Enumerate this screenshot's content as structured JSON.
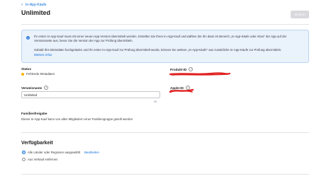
{
  "nav": {
    "back_label": "In-App-Käufe"
  },
  "header": {
    "title": "Unlimited",
    "save_label": "Sichern"
  },
  "info": {
    "paragraph1": "Ihr erster In-App-Kauf muss mit einer neuen App-Version übermittelt werden. Erstellen Sie Ihren In-App-Kauf und wählen Sie ihn dann im Bereich „In-App-Käufe oder Abos“ der App auf der Versionsseite aus, bevor Sie die Version der App zur Prüfung übermitteln.",
    "paragraph2": "Sobald Ihre Binärdatei hochgeladen und Ihr erster In-App-Kauf zur Prüfung übermittelt wurde, können Sie weitere „In-App-Käufe“ aus zusätzliche In-App-Käufe zur Prüfung übermitteln.",
    "link": "Weitere Infos"
  },
  "status": {
    "label": "Status",
    "value": "Fehlende Metadaten"
  },
  "product_id": {
    "label": "Produkt-ID"
  },
  "reference_name": {
    "label": "Verweisname",
    "value": "Unlimited",
    "count": "55"
  },
  "apple_id": {
    "label": "Apple-ID"
  },
  "family_sharing": {
    "label": "Familienfreigabe",
    "text": "Dieser In-App-Kauf kann von allen Mitgliedern einer Familiengruppe geteilt werden"
  },
  "availability": {
    "title": "Verfügbarkeit",
    "option_all": "Alle Länder oder Regionen ausgewählt",
    "edit_label": "Bearbeiten",
    "option_remove": "Aus Verkauf entfernen"
  },
  "colors": {
    "accent": "#0a6cd6",
    "warning": "#f5b400",
    "redaction": "#e0201f",
    "info_bg": "#eaf2fc"
  }
}
